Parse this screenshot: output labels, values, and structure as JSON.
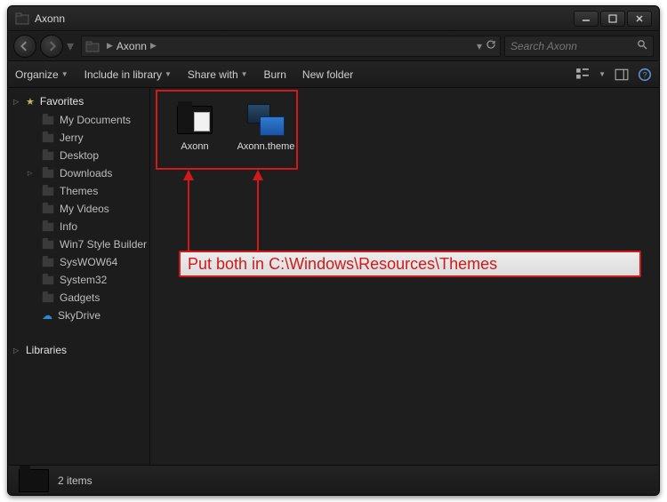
{
  "window": {
    "title": "Axonn"
  },
  "address": {
    "crumbs": [
      "Axonn"
    ],
    "search_placeholder": "Search Axonn"
  },
  "toolbar": {
    "organize": "Organize",
    "include": "Include in library",
    "share": "Share with",
    "burn": "Burn",
    "new_folder": "New folder"
  },
  "sidebar": {
    "favorites_label": "Favorites",
    "libraries_label": "Libraries",
    "items": [
      {
        "label": "My Documents",
        "icon": "folder",
        "expandable": false
      },
      {
        "label": "Jerry",
        "icon": "folder",
        "expandable": false
      },
      {
        "label": "Desktop",
        "icon": "folder",
        "expandable": false
      },
      {
        "label": "Downloads",
        "icon": "folder",
        "expandable": true
      },
      {
        "label": "Themes",
        "icon": "folder",
        "expandable": false
      },
      {
        "label": "My Videos",
        "icon": "folder",
        "expandable": false
      },
      {
        "label": "Info",
        "icon": "folder",
        "expandable": false
      },
      {
        "label": "Win7 Style Builder",
        "icon": "folder",
        "expandable": false
      },
      {
        "label": "SysWOW64",
        "icon": "folder",
        "expandable": false
      },
      {
        "label": "System32",
        "icon": "folder",
        "expandable": false
      },
      {
        "label": "Gadgets",
        "icon": "folder",
        "expandable": false
      },
      {
        "label": "SkyDrive",
        "icon": "skydrive",
        "expandable": false
      }
    ]
  },
  "files": [
    {
      "label": "Axonn",
      "kind": "folder"
    },
    {
      "label": "Axonn.theme",
      "kind": "theme"
    }
  ],
  "callout": {
    "text": "Put both in C:\\Windows\\Resources\\Themes"
  },
  "status": {
    "text": "2 items"
  }
}
